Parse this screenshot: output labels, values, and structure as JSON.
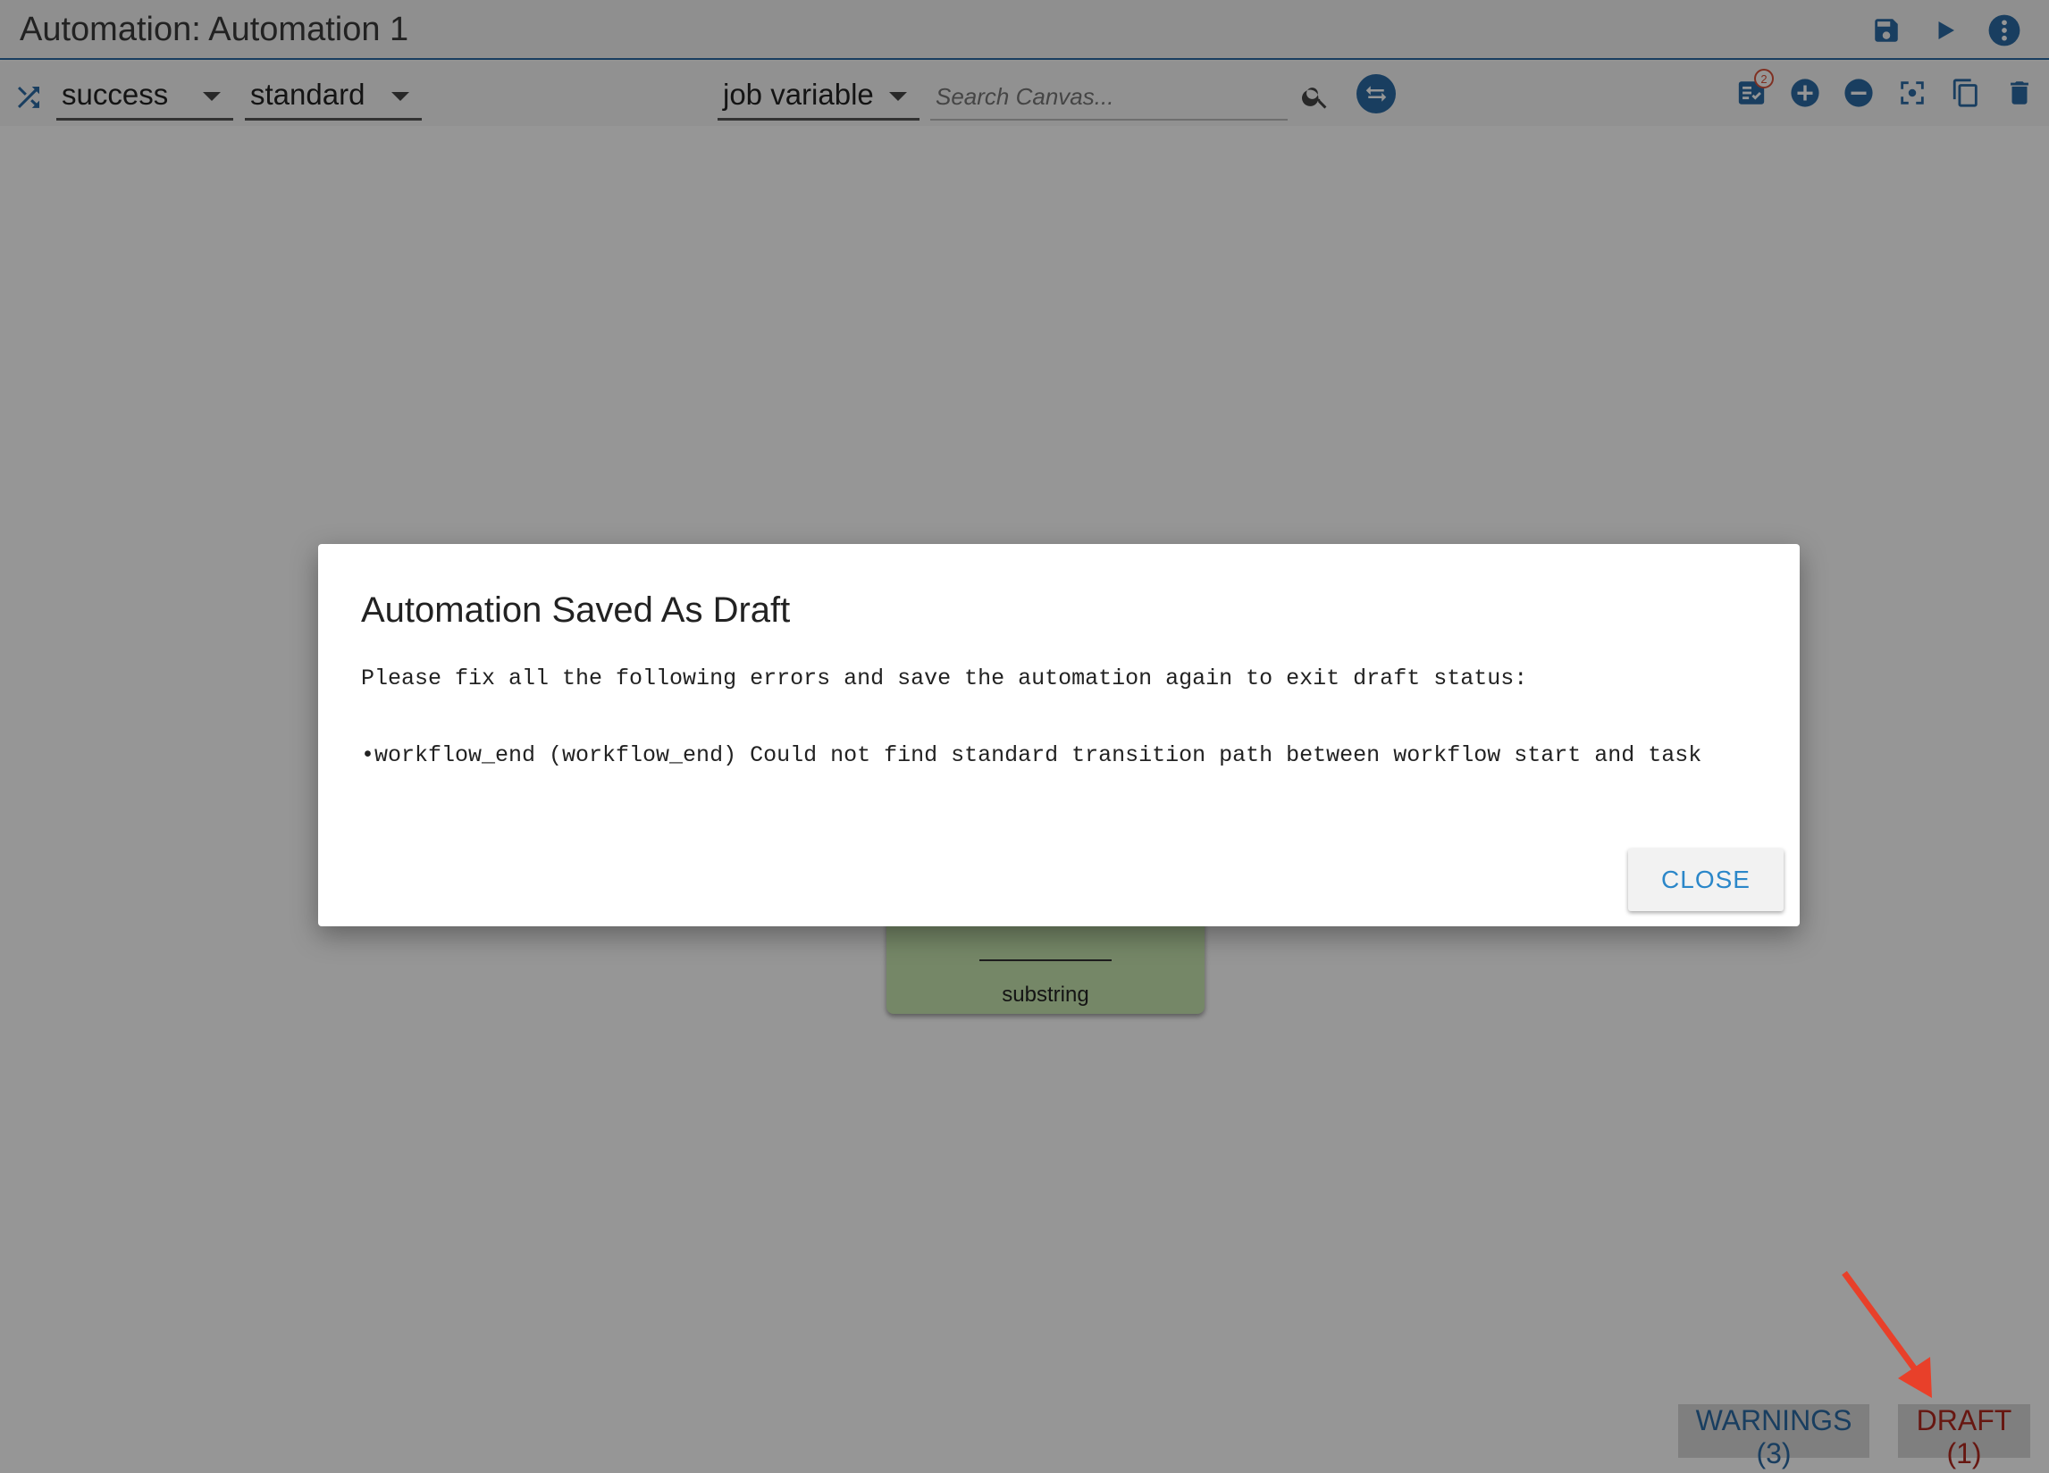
{
  "app": {
    "title": "Automation: Automation 1"
  },
  "toolbar": {
    "transition_type": "success",
    "transition_mode": "standard",
    "variable_type": "job variable",
    "search_placeholder": "Search Canvas...",
    "checklist_badge": "2"
  },
  "canvas": {
    "task_label": "substring"
  },
  "footer": {
    "warnings_label": "WARNINGS (3)",
    "draft_label": "DRAFT (1)"
  },
  "dialog": {
    "title": "Automation Saved As Draft",
    "message": "Please fix all the following errors and save the automation again to exit draft status:",
    "error_item": "•workflow_end (workflow_end) Could not find standard transition path between workflow start and task",
    "close_label": "CLOSE"
  },
  "colors": {
    "accent_blue": "#2b6aa3",
    "link_blue": "#2b87c9",
    "draft_red": "#b0281e",
    "task_green": "#c8e6b0",
    "arrow_red": "#e8402a"
  }
}
